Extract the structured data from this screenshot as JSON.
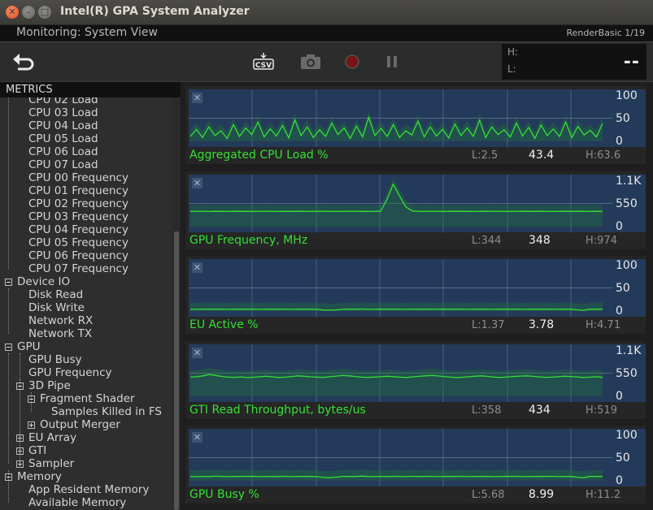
{
  "window": {
    "title": "Intel(R) GPA System Analyzer"
  },
  "header": {
    "left": "Monitoring: System View",
    "right": "RenderBasic 1/19"
  },
  "toolbar": {
    "buttons": [
      {
        "name": "back-icon"
      },
      {
        "name": "csv-icon",
        "label": "CSV"
      },
      {
        "name": "camera-icon"
      },
      {
        "name": "record-icon"
      },
      {
        "name": "pause-icon"
      }
    ]
  },
  "hl_box": {
    "h_label": "H:",
    "l_label": "L:",
    "value": "--"
  },
  "sidebar": {
    "title": "METRICS",
    "items": [
      {
        "label": "CPU 02 Load",
        "depth": 1
      },
      {
        "label": "CPU 03 Load",
        "depth": 1
      },
      {
        "label": "CPU 04 Load",
        "depth": 1
      },
      {
        "label": "CPU 05 Load",
        "depth": 1
      },
      {
        "label": "CPU 06 Load",
        "depth": 1
      },
      {
        "label": "CPU 07 Load",
        "depth": 1
      },
      {
        "label": "CPU 00 Frequency",
        "depth": 1
      },
      {
        "label": "CPU 01 Frequency",
        "depth": 1
      },
      {
        "label": "CPU 02 Frequency",
        "depth": 1
      },
      {
        "label": "CPU 03 Frequency",
        "depth": 1
      },
      {
        "label": "CPU 04 Frequency",
        "depth": 1
      },
      {
        "label": "CPU 05 Frequency",
        "depth": 1
      },
      {
        "label": "CPU 06 Frequency",
        "depth": 1
      },
      {
        "label": "CPU 07 Frequency",
        "depth": 1
      },
      {
        "label": "Device IO",
        "depth": 0,
        "expander": "minus"
      },
      {
        "label": "Disk Read",
        "depth": 1
      },
      {
        "label": "Disk Write",
        "depth": 1
      },
      {
        "label": "Network RX",
        "depth": 1
      },
      {
        "label": "Network TX",
        "depth": 1
      },
      {
        "label": "GPU",
        "depth": 0,
        "expander": "minus"
      },
      {
        "label": "GPU Busy",
        "depth": 1
      },
      {
        "label": "GPU Frequency",
        "depth": 1
      },
      {
        "label": "3D Pipe",
        "depth": 1,
        "expander": "minus"
      },
      {
        "label": "Fragment Shader",
        "depth": 2,
        "expander": "minus"
      },
      {
        "label": "Samples Killed in FS",
        "depth": 3
      },
      {
        "label": "Output Merger",
        "depth": 2,
        "expander": "plus"
      },
      {
        "label": "EU Array",
        "depth": 1,
        "expander": "plus"
      },
      {
        "label": "GTI",
        "depth": 1,
        "expander": "plus"
      },
      {
        "label": "Sampler",
        "depth": 1,
        "expander": "plus"
      },
      {
        "label": "Memory",
        "depth": 0,
        "expander": "minus"
      },
      {
        "label": "App Resident Memory",
        "depth": 1
      },
      {
        "label": "Available Memory",
        "depth": 1
      }
    ]
  },
  "panels": [
    {
      "title": "Aggregated CPU Load %",
      "low": "L:2.5",
      "current": "43.4",
      "high": "H:63.6",
      "ticks": [
        "100",
        "50",
        "0"
      ],
      "ymax": 100,
      "series": [
        10,
        25,
        8,
        30,
        12,
        22,
        6,
        35,
        10,
        28,
        14,
        40,
        9,
        26,
        11,
        33,
        7,
        45,
        12,
        30,
        8,
        24,
        10,
        38,
        14,
        28,
        6,
        32,
        9,
        50,
        12,
        27,
        10,
        35,
        8,
        22,
        13,
        42,
        9,
        30,
        11,
        25,
        7,
        36,
        12,
        28,
        10,
        44,
        8,
        30,
        14,
        24,
        9,
        38,
        11,
        29,
        6,
        34,
        12,
        26,
        10,
        40,
        8,
        31,
        13,
        23,
        9,
        37
      ]
    },
    {
      "title": "GPU Frequency, MHz",
      "low": "L:344",
      "current": "348",
      "high": "H:974",
      "ticks": [
        "1.1K",
        "550",
        "0"
      ],
      "ymax": 1100,
      "series": [
        350,
        348,
        352,
        346,
        350,
        349,
        347,
        351,
        348,
        350,
        346,
        349,
        352,
        348,
        347,
        350,
        349,
        351,
        348,
        346,
        350,
        352,
        349,
        347,
        348,
        350,
        351,
        349,
        348,
        346,
        350,
        620,
        974,
        700,
        450,
        360,
        350,
        348,
        352,
        349,
        347,
        350,
        348,
        351,
        349,
        346,
        350,
        348,
        352,
        349,
        347,
        350,
        348,
        351,
        349,
        350,
        348,
        347,
        349,
        350,
        348,
        351,
        349,
        347,
        350,
        348
      ]
    },
    {
      "title": "EU Active %",
      "low": "L:1.37",
      "current": "3.78",
      "high": "H:4.71",
      "ticks": [
        "100",
        "50",
        "0"
      ],
      "ymax": 100,
      "series": [
        3.8,
        3.6,
        3.9,
        3.7,
        4.0,
        3.8,
        3.5,
        3.9,
        3.7,
        4.1,
        3.8,
        3.6,
        3.9,
        3.7,
        3.8,
        4.0,
        3.6,
        3.9,
        3.7,
        3.8,
        3.5,
        2.0,
        1.8,
        2.2,
        3.6,
        3.9,
        3.7,
        4.2,
        3.8,
        3.6,
        3.9,
        3.7,
        4.0,
        3.8,
        3.6,
        3.9,
        3.7,
        3.8,
        4.1,
        3.6,
        3.9,
        3.7,
        3.8,
        4.0,
        3.6,
        3.9,
        3.7,
        3.8,
        3.5,
        3.9,
        3.7,
        4.0,
        3.8,
        3.6,
        3.9,
        3.7,
        3.8,
        4.0,
        3.6,
        3.9,
        3.7,
        2.5,
        1.6,
        3.8,
        3.7,
        3.9
      ]
    },
    {
      "title": "GTI Read Throughput, bytes/us",
      "low": "L:358",
      "current": "434",
      "high": "H:519",
      "ticks": [
        "1.1K",
        "550",
        "0"
      ],
      "ymax": 1100,
      "series": [
        440,
        450,
        470,
        500,
        480,
        455,
        440,
        435,
        445,
        430,
        438,
        450,
        460,
        445,
        432,
        440,
        455,
        470,
        460,
        448,
        440,
        435,
        450,
        465,
        478,
        470,
        455,
        440,
        435,
        442,
        450,
        460,
        452,
        440,
        432,
        445,
        458,
        470,
        480,
        468,
        455,
        440,
        430,
        438,
        450,
        462,
        470,
        455,
        440,
        432,
        445,
        455,
        465,
        470,
        458,
        445,
        435,
        440,
        450,
        460,
        455,
        445,
        432,
        440,
        450,
        435
      ]
    },
    {
      "title": "GPU Busy %",
      "low": "L:5.68",
      "current": "8.99",
      "high": "H:11.2",
      "ticks": [
        "100",
        "50",
        "0"
      ],
      "ymax": 100,
      "series": [
        9,
        8.5,
        9.2,
        8.8,
        9.5,
        9,
        8.6,
        9.1,
        8.9,
        9.4,
        9,
        8.7,
        9.2,
        8.8,
        9,
        9.3,
        8.6,
        9.1,
        8.9,
        9,
        8.5,
        7,
        6.5,
        7.5,
        8.9,
        9.2,
        8.8,
        9.6,
        9,
        8.7,
        9.2,
        8.8,
        9.3,
        9,
        8.7,
        9.1,
        8.9,
        9,
        9.4,
        8.7,
        9.1,
        8.9,
        9,
        9.3,
        8.7,
        9.1,
        8.9,
        9,
        8.6,
        9.1,
        8.9,
        9.3,
        9,
        8.7,
        9.1,
        8.9,
        9,
        9.3,
        8.7,
        9.1,
        8.9,
        7.5,
        6.2,
        9,
        8.9,
        9.1
      ]
    }
  ],
  "colors": {
    "line": "#33e133",
    "fill": "#1f7a38",
    "plot_bg": "#243a5a",
    "grid": "#7f8fa8"
  }
}
